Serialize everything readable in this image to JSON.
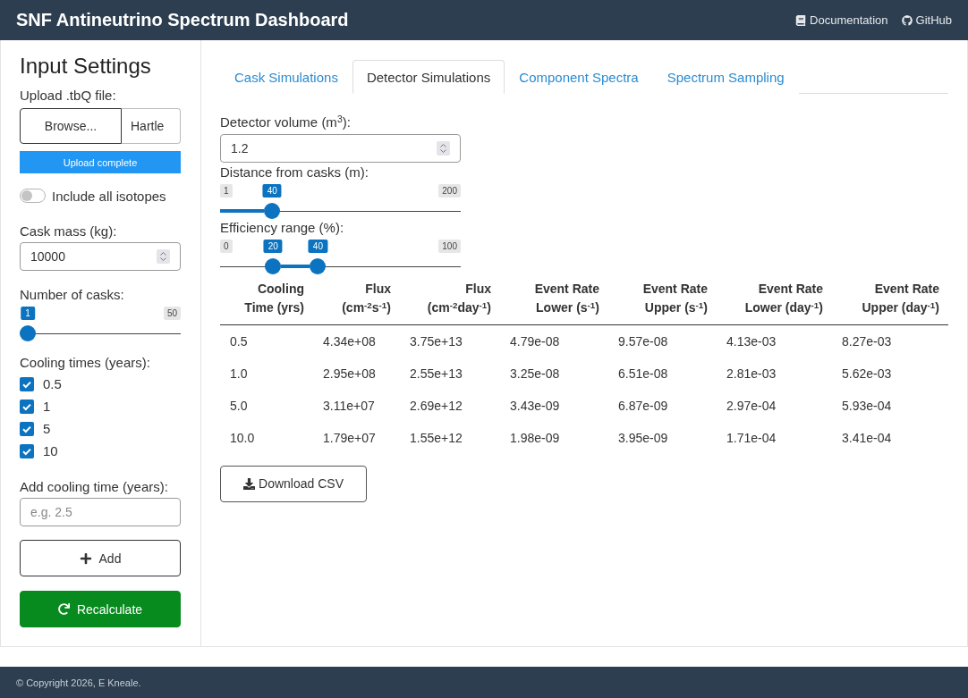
{
  "header": {
    "title": "SNF Antineutrino Spectrum Dashboard",
    "links": [
      {
        "kind": "docs",
        "label": "Documentation"
      },
      {
        "kind": "repo",
        "label": "GitHub"
      }
    ]
  },
  "sidebar": {
    "title": "Input Settings",
    "upload": {
      "label": "Upload .tbQ file:",
      "button": "Browse...",
      "file_name": "Hartle",
      "status": "Upload complete",
      "level": 1
    },
    "isotopes_toggle": {
      "label": "Include all isotopes",
      "on": false
    },
    "cask_mass": {
      "label": "Cask mass (kg):",
      "value": "10000"
    },
    "cask_count": {
      "label": "Number of casks:",
      "max": "50",
      "thumbs": [
        {
          "value": "1",
          "level": 0
        }
      ]
    },
    "cooling_times": {
      "label": "Cooling times (years):",
      "options": [
        {
          "label": "0.5",
          "checked": true
        },
        {
          "label": "1",
          "checked": true
        },
        {
          "label": "5",
          "checked": true
        },
        {
          "label": "10",
          "checked": true
        }
      ]
    },
    "add_cooling": {
      "label": "Add cooling time (years):",
      "placeholder": "e.g. 2.5",
      "button": "Add"
    },
    "recalculate_button": "Recalculate"
  },
  "tabs": [
    {
      "label": "Cask Simulations",
      "selected": false
    },
    {
      "label": "Detector Simulations",
      "selected": true
    },
    {
      "label": "Component Spectra",
      "selected": false
    },
    {
      "label": "Spectrum Sampling",
      "selected": false
    }
  ],
  "detector": {
    "volume": {
      "label": "Detector volume (m$^{3}$):",
      "value": "1.2"
    },
    "distance": {
      "label": "Distance from casks (m):",
      "min": "1",
      "max": "200",
      "thumbs": [
        {
          "value": "40",
          "level": 0.196
        }
      ]
    },
    "efficiency": {
      "label": "Efficiency range (%):",
      "min": "0",
      "max": "100",
      "thumbs": [
        {
          "value": "20",
          "level": 0.2
        },
        {
          "value": "40",
          "level": 0.4
        }
      ]
    }
  },
  "table": {
    "columns": [
      {
        "lines": [
          "Cooling",
          "Time (yrs)"
        ]
      },
      {
        "lines": [
          "Flux",
          "(cm$^{-2}$s$^{-1}$)"
        ]
      },
      {
        "lines": [
          "Flux",
          "(cm$^{-2}$day$^{-1}$)"
        ]
      },
      {
        "lines": [
          "Event Rate",
          "Lower (s$^{-1}$)"
        ]
      },
      {
        "lines": [
          "Event Rate",
          "Upper (s$^{-1}$)"
        ]
      },
      {
        "lines": [
          "Event Rate",
          "Lower (day$^{-1}$)"
        ]
      },
      {
        "lines": [
          "Event Rate",
          "Upper (day$^{-1}$)"
        ]
      }
    ],
    "rows": [
      [
        "0.5",
        "4.34e+08",
        "3.75e+13",
        "4.79e-08",
        "9.57e-08",
        "4.13e-03",
        "8.27e-03"
      ],
      [
        "1.0",
        "2.95e+08",
        "2.55e+13",
        "3.25e-08",
        "6.51e-08",
        "2.81e-03",
        "5.62e-03"
      ],
      [
        "5.0",
        "3.11e+07",
        "2.69e+12",
        "3.43e-09",
        "6.87e-09",
        "2.97e-04",
        "5.93e-04"
      ],
      [
        "10.0",
        "1.79e+07",
        "1.55e+12",
        "1.98e-09",
        "3.95e-09",
        "1.71e-04",
        "3.41e-04"
      ]
    ]
  },
  "download_button": "Download CSV",
  "footer": "© Copyright 2026, E Kneale."
}
